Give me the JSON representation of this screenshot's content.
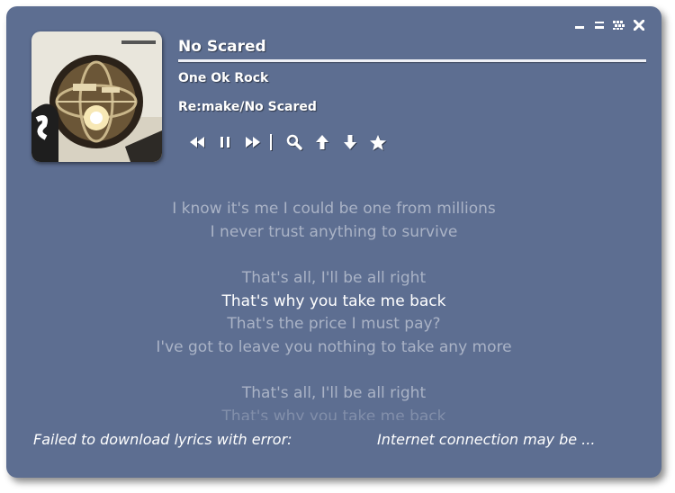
{
  "window": {
    "controls": [
      {
        "name": "minimize-icon"
      },
      {
        "name": "restore-icon"
      },
      {
        "name": "grid-icon"
      },
      {
        "name": "close-icon",
        "label": "x"
      }
    ]
  },
  "track": {
    "title": "No Scared",
    "artist": "One Ok Rock",
    "album": "Re:make/No Scared"
  },
  "player_controls": [
    {
      "name": "rewind-icon"
    },
    {
      "name": "pause-icon"
    },
    {
      "name": "fast-forward-icon"
    },
    {
      "name": "search-icon"
    },
    {
      "name": "arrow-up-icon"
    },
    {
      "name": "arrow-down-icon"
    },
    {
      "name": "star-icon"
    }
  ],
  "lyrics": {
    "lines": [
      "I know it's me I could be one from millions",
      "I never trust anything to survive",
      "",
      "That's all, I'll be all right",
      "That's why you take me back",
      "That's the price I must pay?",
      "I've got to leave you nothing to take any more",
      "",
      "That's all, I'll be all right",
      "That's why you take me back"
    ],
    "current_line": "That's why you take me back"
  },
  "status": {
    "message": "Failed to download lyrics with error:",
    "detail": "Internet connection may be ..."
  },
  "colors": {
    "panel": "#5d6e91",
    "lyric_dim": "#aab3c6",
    "lyric_current": "#ffffff"
  }
}
